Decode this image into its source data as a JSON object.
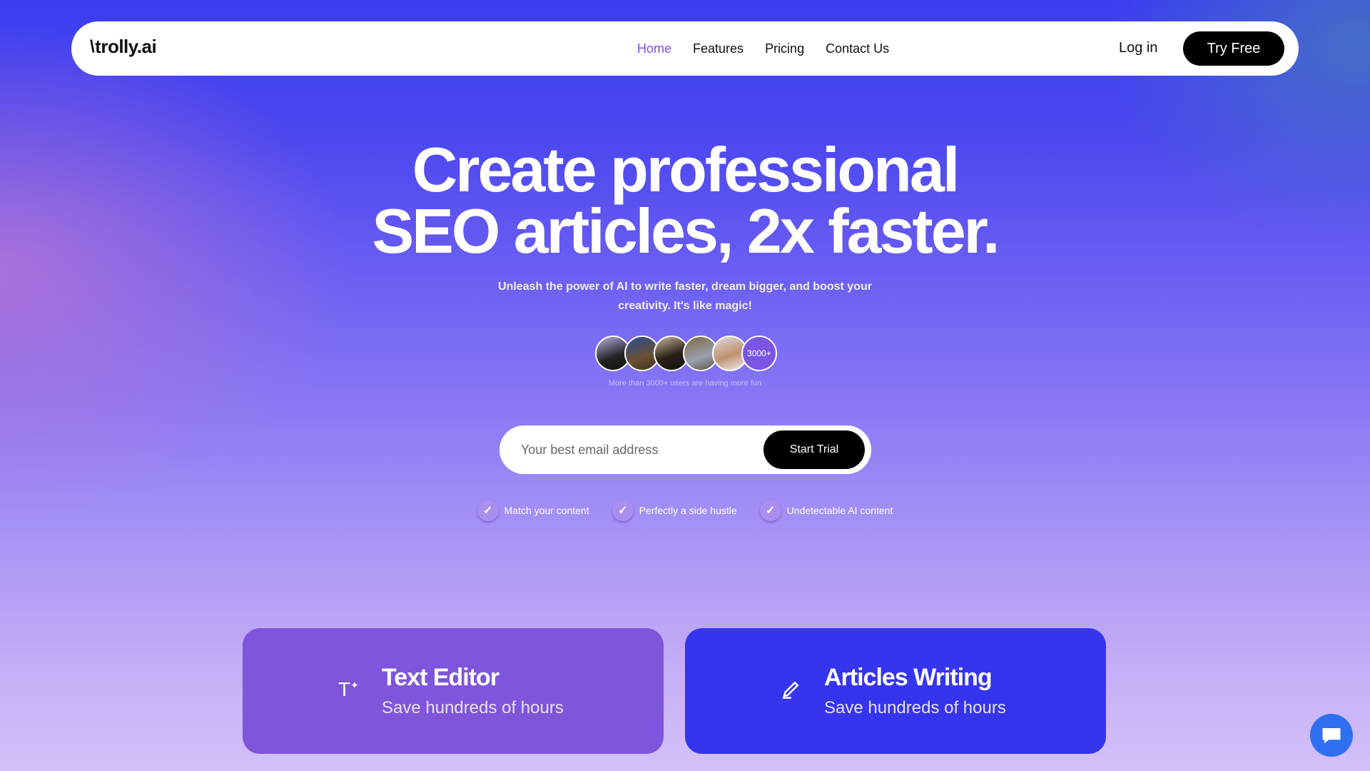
{
  "nav": {
    "logo": "trolly.ai",
    "logo_mark": "\\",
    "items": [
      {
        "label": "Home",
        "active": true
      },
      {
        "label": "Features",
        "active": false
      },
      {
        "label": "Pricing",
        "active": false
      },
      {
        "label": "Contact Us",
        "active": false
      }
    ],
    "login": "Log in",
    "try_free": "Try Free"
  },
  "hero": {
    "title_line1": "Create professional",
    "title_line2": "SEO articles, 2x faster.",
    "subtitle_line1": "Unleash the power of AI to write faster, dream bigger, and boost your",
    "subtitle_line2": "creativity. It's like magic!",
    "user_count_badge": "3000+",
    "users_note": "More than 3000+ users are having more fun"
  },
  "signup": {
    "email_placeholder": "Your best email address",
    "email_value": "",
    "button": "Start Trial"
  },
  "checks": [
    {
      "icon": "check-icon",
      "label": "Match your content"
    },
    {
      "icon": "check-icon",
      "label": "Perfectly a side hustle"
    },
    {
      "icon": "check-icon",
      "label": "Undetectable AI content"
    }
  ],
  "cards": [
    {
      "icon": "text-sparkle-icon",
      "title": "Text Editor",
      "subtitle": "Save hundreds of hours"
    },
    {
      "icon": "pen-icon",
      "title": "Articles Writing",
      "subtitle": "Save hundreds of hours"
    }
  ],
  "colors": {
    "accent": "#7a4fe0",
    "card_left": "#7f55db",
    "card_right": "#3535ee",
    "chat": "#2d6ff0"
  }
}
